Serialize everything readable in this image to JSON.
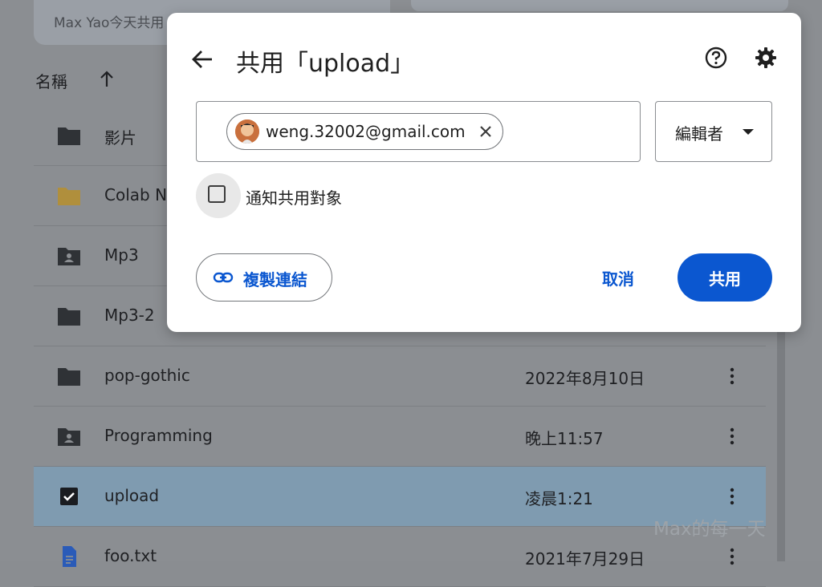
{
  "background": {
    "banner_text": "Max Yao今天共用",
    "list_header": "名稱",
    "sort_icon": "arrow-up-icon",
    "rows": [
      {
        "name": "影片",
        "date": "",
        "icon": "folder-icon"
      },
      {
        "name": "Colab N",
        "date": "",
        "icon": "folder-icon-yellow"
      },
      {
        "name": "Mp3",
        "date": "",
        "icon": "shared-folder-icon"
      },
      {
        "name": "Mp3-2",
        "date": "",
        "icon": "folder-icon"
      },
      {
        "name": "pop-gothic",
        "date": "2022年8月10日",
        "icon": "folder-icon"
      },
      {
        "name": "Programming",
        "date": "晚上11:57",
        "icon": "shared-folder-icon"
      },
      {
        "name": "upload",
        "date": "凌晨1:21",
        "icon": "checkbox-checked-icon"
      },
      {
        "name": "foo.txt",
        "date": "2021年7月29日",
        "icon": "doc-icon"
      }
    ],
    "watermark": "Max的每一天"
  },
  "dialog": {
    "title": "共用「upload」",
    "recipient_email": "weng.32002@gmail.com",
    "role": "編輯者",
    "notify_label": "通知共用對象",
    "notify_checked": false,
    "copy_link_label": "複製連結",
    "cancel_label": "取消",
    "share_label": "共用"
  },
  "colors": {
    "accent": "#0b57d0",
    "selected_row": "#7f9bb0",
    "scrim": "#8b8e92"
  }
}
